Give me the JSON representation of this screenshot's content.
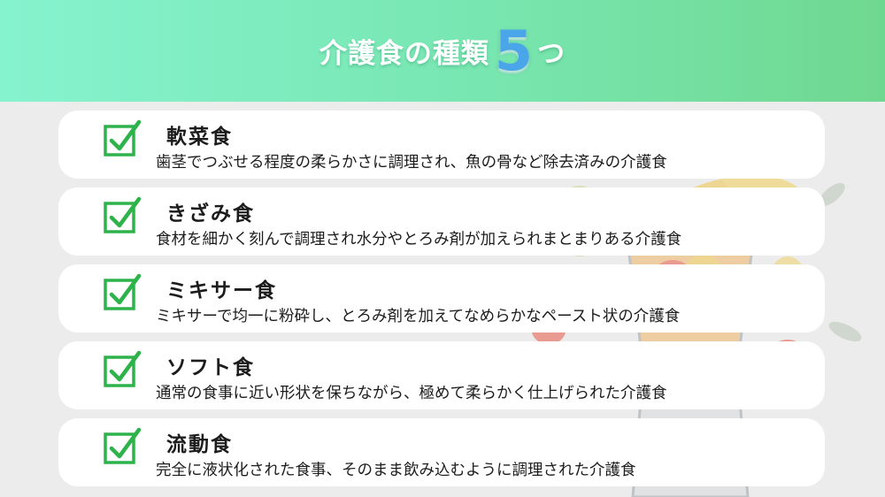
{
  "header": {
    "title_before": "介護食の種類",
    "title_number": "5",
    "title_after": "つ"
  },
  "colors": {
    "header_start": "#86f3cf",
    "header_end": "#6fd890",
    "check": "#2db34a",
    "number": "#4aa6e8"
  },
  "items": [
    {
      "title": "軟菜食",
      "desc": "歯茎でつぶせる程度の柔らかさに調理され、魚の骨など除去済みの介護食",
      "icon": "checkbox-checked-icon"
    },
    {
      "title": "きざみ食",
      "desc": "食材を細かく刻んで調理され水分やとろみ剤が加えられまとまりある介護食",
      "icon": "checkbox-checked-icon"
    },
    {
      "title": "ミキサー食",
      "desc": "ミキサーで均一に粉砕し、とろみ剤を加えてなめらかなペースト状の介護食",
      "icon": "checkbox-checked-icon"
    },
    {
      "title": "ソフト食",
      "desc": "通常の食事に近い形状を保ちながら、極めて柔らかく仕上げられた介護食",
      "icon": "checkbox-checked-icon"
    },
    {
      "title": "流動食",
      "desc": "完全に液状化された食事、そのまま飲み込むように調理された介護食",
      "icon": "checkbox-checked-icon"
    }
  ],
  "background_illustration": "blender-with-fruits-illustration"
}
